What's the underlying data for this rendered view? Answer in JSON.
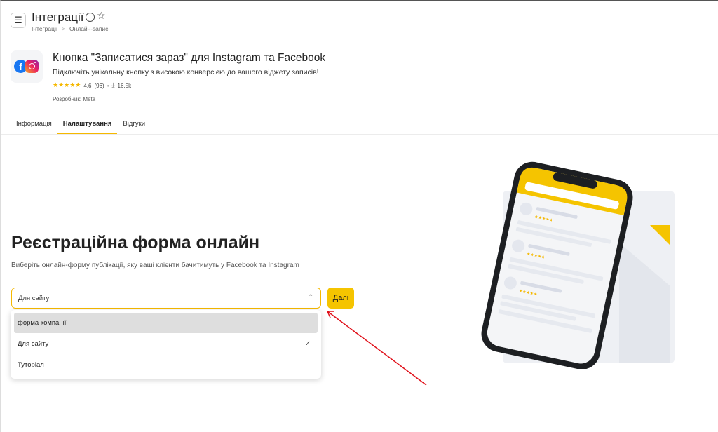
{
  "header": {
    "title": "Інтеграції",
    "breadcrumb": [
      "Інтеграції",
      "Онлайн-запис"
    ],
    "menu_icon": "☰",
    "info_icon": "i",
    "favorite_icon": "☆"
  },
  "app": {
    "title": "Кнопка \"Записатися зараз\" для Instagram та Facebook",
    "description": "Підключіть унікальну кнопку з високою конверсією до вашого віджету записів!",
    "stars": "★★★★★",
    "rating": "4.6",
    "reviews_count": "(96)",
    "bullet": "•",
    "download_icon": "⤓",
    "downloads": "16.5k",
    "developer": "Розробник: Meta",
    "logo_letter": "f"
  },
  "tabs": [
    {
      "label": "Інформація",
      "active": false
    },
    {
      "label": "Налаштування",
      "active": true
    },
    {
      "label": "Відгуки",
      "active": false
    }
  ],
  "main": {
    "heading": "Реєстраційна форма онлайн",
    "subtitle": "Виберіть онлайн-форму публікації, яку ваші клієнти бачитимуть у Facebook та Instagram",
    "select_value": "Для сайту",
    "chevron_icon": "⌃",
    "next_label": "Далі",
    "options": [
      {
        "label": "форма компанії",
        "hovered": true,
        "selected": false
      },
      {
        "label": "Для сайту",
        "hovered": false,
        "selected": true
      },
      {
        "label": "Туторіал",
        "hovered": false,
        "selected": false
      }
    ],
    "check_icon": "✓"
  },
  "colors": {
    "accent": "#f5c400",
    "arrow": "#e0101a",
    "facebook": "#1877f2"
  }
}
